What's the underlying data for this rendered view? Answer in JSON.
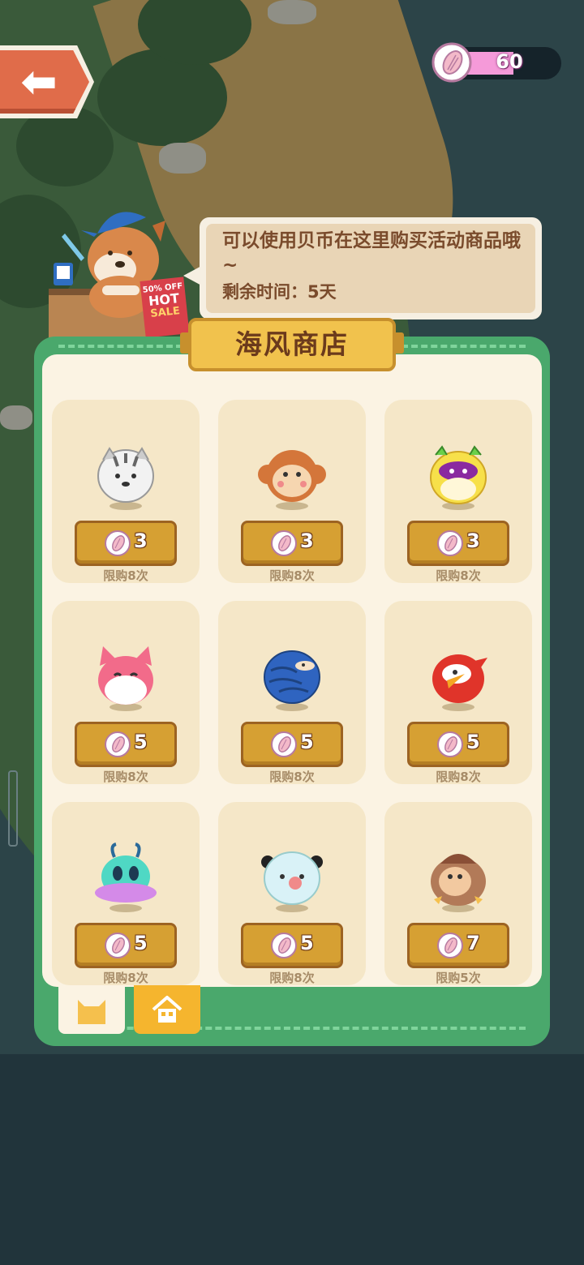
{
  "currency": {
    "value": "60",
    "fill_fraction": 0.6
  },
  "shopkeeper": {
    "sign_discount": "50% OFF",
    "sign_hot": "HOT",
    "sign_sale": "SALE"
  },
  "bubble": {
    "text": "可以使用贝币在这里购买活动商品哦~",
    "time_label": "剩余时间：5天"
  },
  "shop": {
    "title": "海风商店",
    "items": [
      {
        "name": "tiger",
        "price": "3",
        "limit": "限购8次"
      },
      {
        "name": "monkey",
        "price": "3",
        "limit": "限购8次"
      },
      {
        "name": "leopard",
        "price": "3",
        "limit": "限购8次"
      },
      {
        "name": "fox",
        "price": "5",
        "limit": "限购8次"
      },
      {
        "name": "pangolin",
        "price": "5",
        "limit": "限购8次"
      },
      {
        "name": "bird",
        "price": "5",
        "limit": "限购8次"
      },
      {
        "name": "alien",
        "price": "5",
        "limit": "限购8次"
      },
      {
        "name": "panda",
        "price": "5",
        "limit": "限购8次"
      },
      {
        "name": "owl",
        "price": "7",
        "limit": "限购5次"
      }
    ]
  },
  "tabs": [
    {
      "icon": "cat-icon",
      "active": true
    },
    {
      "icon": "house-icon",
      "active": false
    }
  ],
  "colors": {
    "panel": "#4aa86c",
    "price_button": "#d6a033",
    "currency_fill": "#f59ad9"
  }
}
